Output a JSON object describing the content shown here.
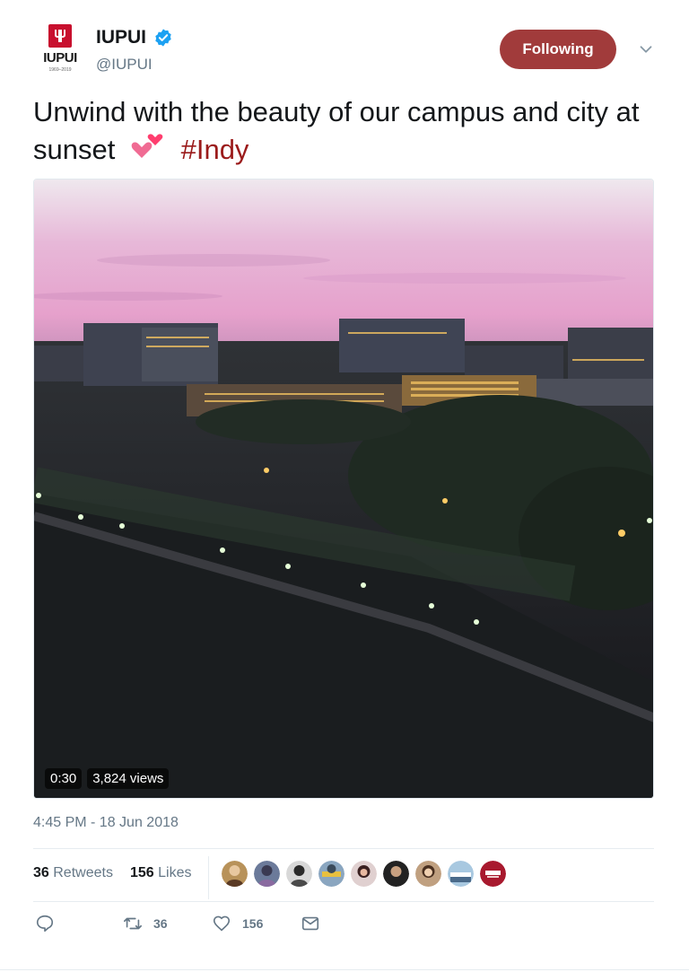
{
  "account": {
    "display_name": "IUPUI",
    "handle": "@IUPUI",
    "logo_text": "IUPUI",
    "logo_years": "1969–2019",
    "verified": true
  },
  "follow_button": {
    "label": "Following"
  },
  "tweet": {
    "text": "Unwind with the beauty of our campus and city at sunset",
    "emoji": "two-hearts",
    "hashtag": "#Indy"
  },
  "video": {
    "duration": "0:30",
    "views": "3,824 views"
  },
  "timestamp": "4:45 PM - 18 Jun 2018",
  "stats": {
    "retweets_count": "36",
    "retweets_label": "Retweets",
    "likes_count": "156",
    "likes_label": "Likes",
    "avatar_count": 9
  },
  "actions": {
    "reply_icon": "reply-icon",
    "retweet_icon": "retweet-icon",
    "retweet_count": "36",
    "like_icon": "heart-icon",
    "like_count": "156",
    "dm_icon": "envelope-icon"
  },
  "colors": {
    "follow_button_bg": "#a13b3b",
    "hashtag": "#9b1b1b",
    "brand_red": "#c8102e",
    "secondary_text": "#657786",
    "verified_blue": "#1da1f2"
  }
}
